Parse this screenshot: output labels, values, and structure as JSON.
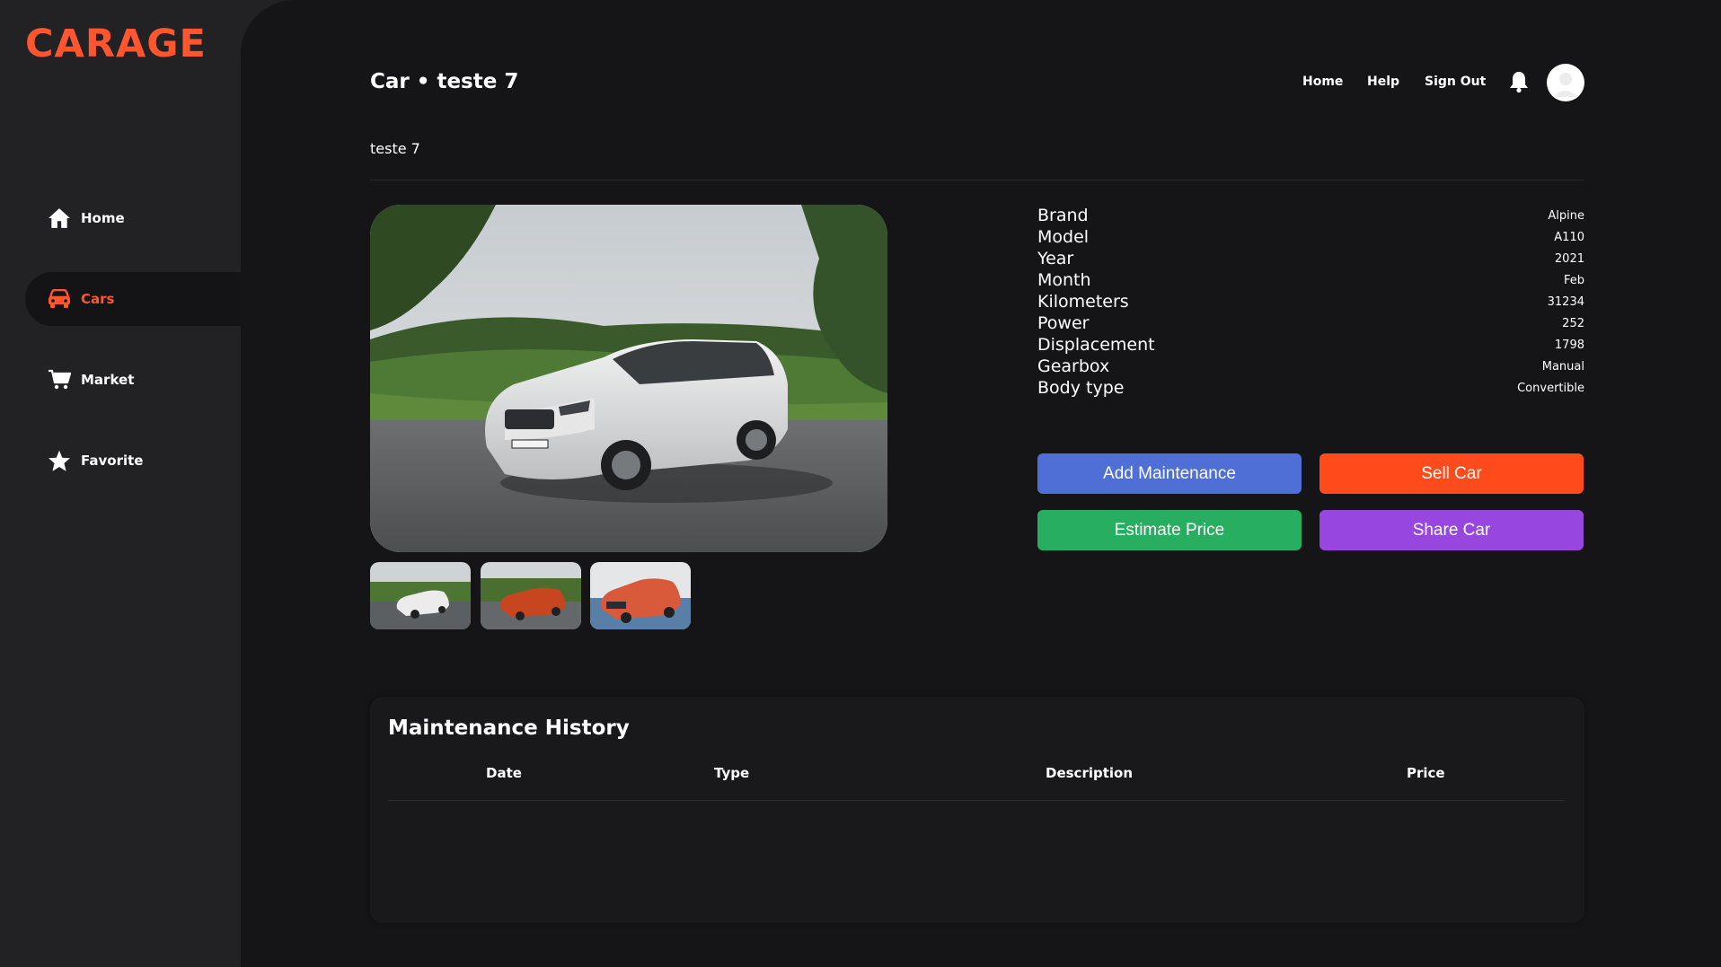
{
  "sidebar": {
    "logo": "CARAGE",
    "items": [
      {
        "label": "Home",
        "icon": "home-icon"
      },
      {
        "label": "Cars",
        "icon": "car-icon",
        "active": true
      },
      {
        "label": "Market",
        "icon": "cart-icon"
      },
      {
        "label": "Favorite",
        "icon": "star-icon"
      }
    ]
  },
  "header": {
    "title": "Car • teste 7",
    "nav": [
      "Home",
      "Help",
      "Sign Out"
    ],
    "bell_icon": "bell-icon",
    "avatar_icon": "user-avatar-icon"
  },
  "car": {
    "name": "teste 7",
    "specs": [
      {
        "label": "Brand",
        "value": "Alpine"
      },
      {
        "label": "Model",
        "value": "A110"
      },
      {
        "label": "Year",
        "value": "2021"
      },
      {
        "label": "Month",
        "value": "Feb"
      },
      {
        "label": "Kilometers",
        "value": "31234"
      },
      {
        "label": "Power",
        "value": "252"
      },
      {
        "label": "Displacement",
        "value": "1798"
      },
      {
        "label": "Gearbox",
        "value": "Manual"
      },
      {
        "label": "Body type",
        "value": "Convertible"
      }
    ]
  },
  "actions": {
    "add_maintenance": "Add Maintenance",
    "sell_car": "Sell Car",
    "estimate_price": "Estimate Price",
    "share_car": "Share Car"
  },
  "colors": {
    "accent": "#ff5630",
    "add_maintenance": "#4f6fd6",
    "sell_car": "#ff4a1c",
    "estimate_price": "#27ae60",
    "share_car": "#9747e0"
  },
  "maintenance": {
    "title": "Maintenance History",
    "columns": [
      "Date",
      "Type",
      "Description",
      "Price"
    ],
    "rows": []
  }
}
